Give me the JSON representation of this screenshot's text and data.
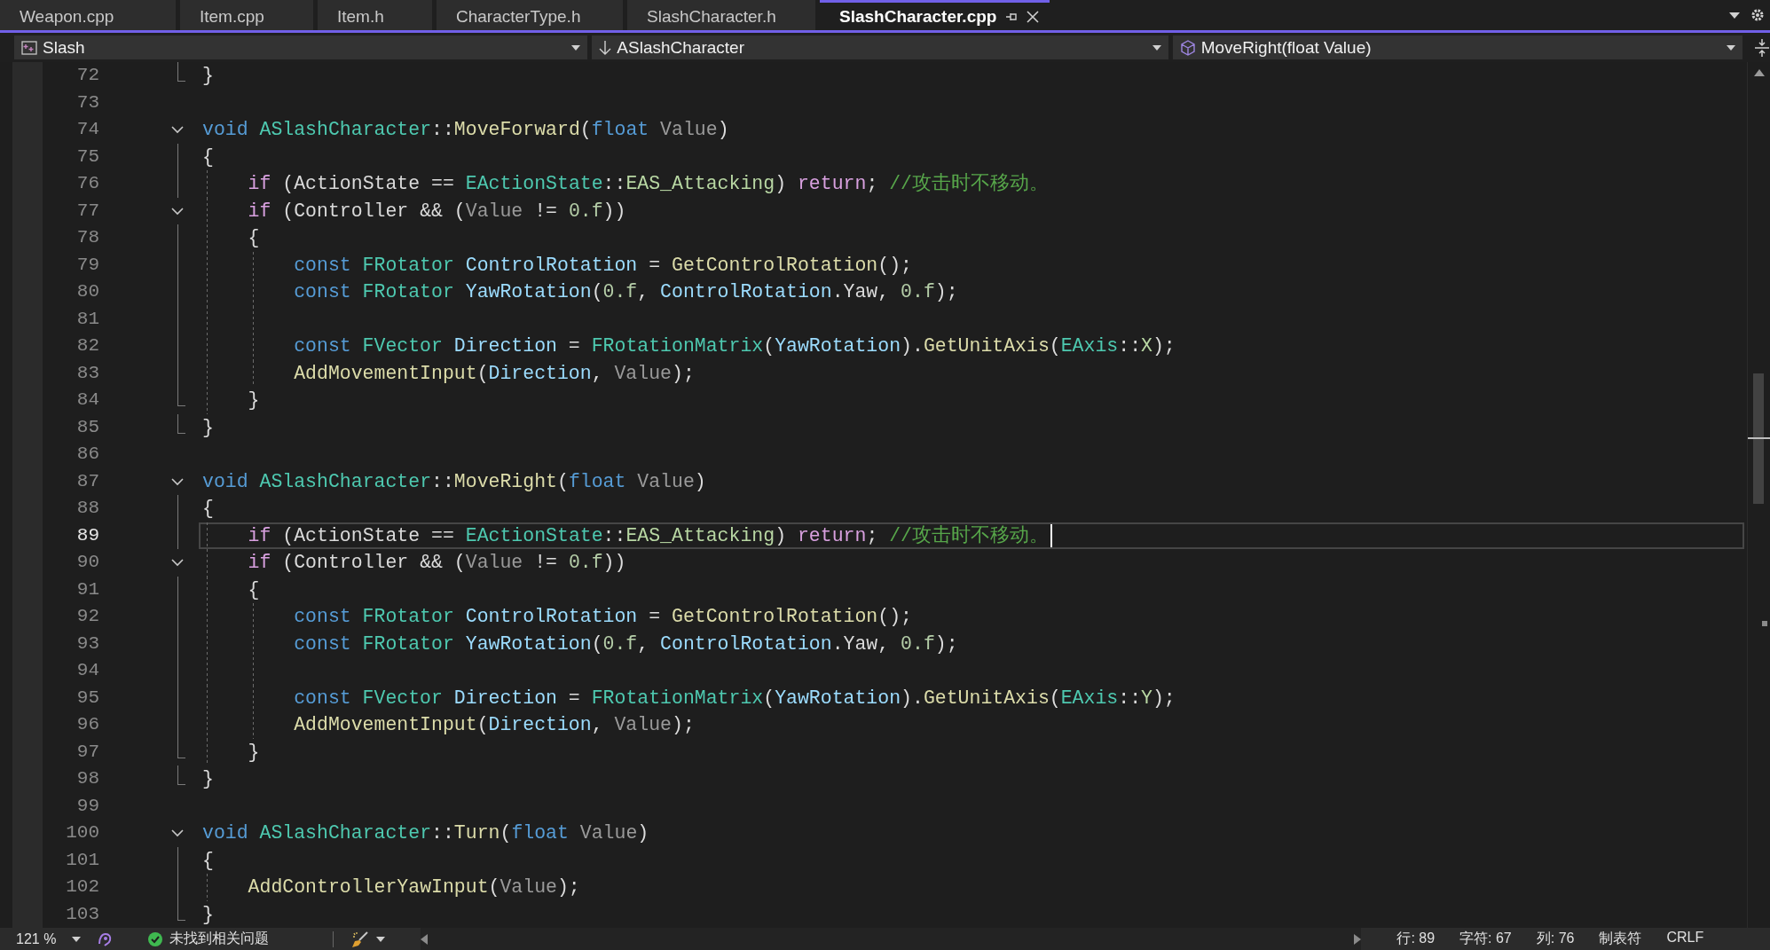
{
  "tabs": [
    {
      "label": "Weapon.cpp",
      "selected": false
    },
    {
      "label": "Item.cpp",
      "selected": false
    },
    {
      "label": "Item.h",
      "selected": false
    },
    {
      "label": "CharacterType.h",
      "selected": false
    },
    {
      "label": "SlashCharacter.h",
      "selected": false
    },
    {
      "label": "SlashCharacter.cpp",
      "selected": true
    }
  ],
  "navigation": {
    "project": "Slash",
    "scope": "ASlashCharacter",
    "member": "MoveRight(float Value)"
  },
  "code_lines": [
    {
      "children": [
        {
          "number": "72",
          "current": false,
          "tokens": [
            {
              "kind": "plain",
              "text": "}"
            }
          ]
        }
      ]
    },
    {
      "number": "73",
      "current": false
    },
    {
      "number": "74",
      "current": false,
      "expanded": true,
      "tokens": [
        {
          "kind": "kw",
          "text": "void"
        },
        {
          "kind": "type",
          "text": " ASlashCharacter"
        },
        {
          "kind": "plain",
          "text": "::"
        },
        {
          "kind": "fn",
          "text": "MoveForward"
        },
        {
          "kind": "plain",
          "text": "("
        },
        {
          "kind": "kw",
          "text": "float"
        },
        {
          "kind": "param",
          "text": " Value"
        },
        {
          "kind": "plain",
          "text": ")"
        }
      ],
      "children": [
        {
          "number": "75",
          "current": false,
          "tokens": [
            {
              "kind": "plain",
              "text": "{"
            }
          ]
        },
        {
          "number": "76",
          "current": false,
          "tokens": [
            {
              "kind": "ctl",
              "text": "    if"
            },
            {
              "kind": "plain",
              "text": " ("
            },
            {
              "kind": "member",
              "text": "ActionState"
            },
            {
              "kind": "plain",
              "text": " == "
            },
            {
              "kind": "type",
              "text": "EActionState"
            },
            {
              "kind": "plain",
              "text": "::"
            },
            {
              "kind": "enum",
              "text": "EAS_Attacking"
            },
            {
              "kind": "plain",
              "text": ") "
            },
            {
              "kind": "ctl",
              "text": "return"
            },
            {
              "kind": "plain",
              "text": ";"
            },
            {
              "kind": "comment",
              "text": " //攻击时不移动。"
            }
          ]
        },
        {
          "number": "77",
          "current": false,
          "expanded": true,
          "tokens": [
            {
              "kind": "ctl",
              "text": "    if"
            },
            {
              "kind": "plain",
              "text": " ("
            },
            {
              "kind": "member",
              "text": "Controller"
            },
            {
              "kind": "plain",
              "text": " && ("
            },
            {
              "kind": "param",
              "text": "Value"
            },
            {
              "kind": "plain",
              "text": " != "
            },
            {
              "kind": "num",
              "text": "0.f"
            },
            {
              "kind": "plain",
              "text": "))"
            }
          ],
          "children": [
            {
              "number": "78",
              "current": false,
              "tokens": [
                {
                  "kind": "plain",
                  "text": "    {"
                }
              ]
            },
            {
              "number": "79",
              "current": false,
              "tokens": [
                {
                  "kind": "kw",
                  "text": "        const"
                },
                {
                  "kind": "type",
                  "text": " FRotator"
                },
                {
                  "kind": "local",
                  "text": " ControlRotation"
                },
                {
                  "kind": "plain",
                  "text": " = "
                },
                {
                  "kind": "fn",
                  "text": "GetControlRotation"
                },
                {
                  "kind": "plain",
                  "text": "();"
                }
              ]
            },
            {
              "number": "80",
              "current": false,
              "tokens": [
                {
                  "kind": "kw",
                  "text": "        const"
                },
                {
                  "kind": "type",
                  "text": " FRotator"
                },
                {
                  "kind": "local",
                  "text": " YawRotation"
                },
                {
                  "kind": "plain",
                  "text": "("
                },
                {
                  "kind": "num",
                  "text": "0.f"
                },
                {
                  "kind": "plain",
                  "text": ", "
                },
                {
                  "kind": "local",
                  "text": "ControlRotation"
                },
                {
                  "kind": "plain",
                  "text": "."
                },
                {
                  "kind": "member",
                  "text": "Yaw"
                },
                {
                  "kind": "plain",
                  "text": ", "
                },
                {
                  "kind": "num",
                  "text": "0.f"
                },
                {
                  "kind": "plain",
                  "text": ");"
                }
              ]
            },
            {
              "number": "81",
              "current": false
            },
            {
              "number": "82",
              "current": false,
              "tokens": [
                {
                  "kind": "kw",
                  "text": "        const"
                },
                {
                  "kind": "type",
                  "text": " FVector"
                },
                {
                  "kind": "local",
                  "text": " Direction"
                },
                {
                  "kind": "plain",
                  "text": " = "
                },
                {
                  "kind": "type",
                  "text": "FRotationMatrix"
                },
                {
                  "kind": "plain",
                  "text": "("
                },
                {
                  "kind": "local",
                  "text": "YawRotation"
                },
                {
                  "kind": "plain",
                  "text": ")."
                },
                {
                  "kind": "fn",
                  "text": "GetUnitAxis"
                },
                {
                  "kind": "plain",
                  "text": "("
                },
                {
                  "kind": "type",
                  "text": "EAxis"
                },
                {
                  "kind": "plain",
                  "text": "::"
                },
                {
                  "kind": "enum",
                  "text": "X"
                },
                {
                  "kind": "plain",
                  "text": ");"
                }
              ]
            },
            {
              "number": "83",
              "current": false,
              "tokens": [
                {
                  "kind": "fn",
                  "text": "        AddMovementInput"
                },
                {
                  "kind": "plain",
                  "text": "("
                },
                {
                  "kind": "local",
                  "text": "Direction"
                },
                {
                  "kind": "plain",
                  "text": ", "
                },
                {
                  "kind": "param",
                  "text": "Value"
                },
                {
                  "kind": "plain",
                  "text": ");"
                }
              ]
            },
            {
              "number": "84",
              "current": false,
              "tokens": [
                {
                  "kind": "plain",
                  "text": "    }"
                }
              ]
            }
          ]
        },
        {
          "number": "85",
          "current": false,
          "tokens": [
            {
              "kind": "plain",
              "text": "}"
            }
          ]
        }
      ]
    },
    {
      "number": "86",
      "current": false
    },
    {
      "number": "87",
      "current": false,
      "expanded": true,
      "tokens": [
        {
          "kind": "kw",
          "text": "void"
        },
        {
          "kind": "type",
          "text": " ASlashCharacter"
        },
        {
          "kind": "plain",
          "text": "::"
        },
        {
          "kind": "fn",
          "text": "MoveRight"
        },
        {
          "kind": "plain",
          "text": "("
        },
        {
          "kind": "kw",
          "text": "float"
        },
        {
          "kind": "param",
          "text": " Value"
        },
        {
          "kind": "plain",
          "text": ")"
        }
      ],
      "children": [
        {
          "number": "88",
          "current": false,
          "tokens": [
            {
              "kind": "plain",
              "text": "{"
            }
          ]
        },
        {
          "number": "89",
          "current": true,
          "tokens": [
            {
              "kind": "ctl",
              "text": "    if"
            },
            {
              "kind": "plain",
              "text": " ("
            },
            {
              "kind": "member",
              "text": "ActionState"
            },
            {
              "kind": "plain",
              "text": " == "
            },
            {
              "kind": "type",
              "text": "EActionState"
            },
            {
              "kind": "plain",
              "text": "::"
            },
            {
              "kind": "enum",
              "text": "EAS_Attacking"
            },
            {
              "kind": "plain",
              "text": ") "
            },
            {
              "kind": "ctl",
              "text": "return"
            },
            {
              "kind": "plain",
              "text": ";"
            },
            {
              "kind": "comment",
              "text": " //攻击时不移动。"
            }
          ]
        },
        {
          "number": "90",
          "current": false,
          "expanded": true,
          "tokens": [
            {
              "kind": "ctl",
              "text": "    if"
            },
            {
              "kind": "plain",
              "text": " ("
            },
            {
              "kind": "member",
              "text": "Controller"
            },
            {
              "kind": "plain",
              "text": " && ("
            },
            {
              "kind": "param",
              "text": "Value"
            },
            {
              "kind": "plain",
              "text": " != "
            },
            {
              "kind": "num",
              "text": "0.f"
            },
            {
              "kind": "plain",
              "text": "))"
            }
          ],
          "children": [
            {
              "number": "91",
              "current": false,
              "tokens": [
                {
                  "kind": "plain",
                  "text": "    {"
                }
              ]
            },
            {
              "number": "92",
              "current": false,
              "tokens": [
                {
                  "kind": "kw",
                  "text": "        const"
                },
                {
                  "kind": "type",
                  "text": " FRotator"
                },
                {
                  "kind": "local",
                  "text": " ControlRotation"
                },
                {
                  "kind": "plain",
                  "text": " = "
                },
                {
                  "kind": "fn",
                  "text": "GetControlRotation"
                },
                {
                  "kind": "plain",
                  "text": "();"
                }
              ]
            },
            {
              "number": "93",
              "current": false,
              "tokens": [
                {
                  "kind": "kw",
                  "text": "        const"
                },
                {
                  "kind": "type",
                  "text": " FRotator"
                },
                {
                  "kind": "local",
                  "text": " YawRotation"
                },
                {
                  "kind": "plain",
                  "text": "("
                },
                {
                  "kind": "num",
                  "text": "0.f"
                },
                {
                  "kind": "plain",
                  "text": ", "
                },
                {
                  "kind": "local",
                  "text": "ControlRotation"
                },
                {
                  "kind": "plain",
                  "text": "."
                },
                {
                  "kind": "member",
                  "text": "Yaw"
                },
                {
                  "kind": "plain",
                  "text": ", "
                },
                {
                  "kind": "num",
                  "text": "0.f"
                },
                {
                  "kind": "plain",
                  "text": ");"
                }
              ]
            },
            {
              "number": "94",
              "current": false
            },
            {
              "number": "95",
              "current": false,
              "tokens": [
                {
                  "kind": "kw",
                  "text": "        const"
                },
                {
                  "kind": "type",
                  "text": " FVector"
                },
                {
                  "kind": "local",
                  "text": " Direction"
                },
                {
                  "kind": "plain",
                  "text": " = "
                },
                {
                  "kind": "type",
                  "text": "FRotationMatrix"
                },
                {
                  "kind": "plain",
                  "text": "("
                },
                {
                  "kind": "local",
                  "text": "YawRotation"
                },
                {
                  "kind": "plain",
                  "text": ")."
                },
                {
                  "kind": "fn",
                  "text": "GetUnitAxis"
                },
                {
                  "kind": "plain",
                  "text": "("
                },
                {
                  "kind": "type",
                  "text": "EAxis"
                },
                {
                  "kind": "plain",
                  "text": "::"
                },
                {
                  "kind": "enum",
                  "text": "Y"
                },
                {
                  "kind": "plain",
                  "text": ");"
                }
              ]
            },
            {
              "number": "96",
              "current": false,
              "tokens": [
                {
                  "kind": "fn",
                  "text": "        AddMovementInput"
                },
                {
                  "kind": "plain",
                  "text": "("
                },
                {
                  "kind": "local",
                  "text": "Direction"
                },
                {
                  "kind": "plain",
                  "text": ", "
                },
                {
                  "kind": "param",
                  "text": "Value"
                },
                {
                  "kind": "plain",
                  "text": ");"
                }
              ]
            },
            {
              "number": "97",
              "current": false,
              "tokens": [
                {
                  "kind": "plain",
                  "text": "    }"
                }
              ]
            }
          ]
        },
        {
          "number": "98",
          "current": false,
          "tokens": [
            {
              "kind": "plain",
              "text": "}"
            }
          ]
        }
      ]
    },
    {
      "number": "99",
      "current": false
    },
    {
      "number": "100",
      "current": false,
      "expanded": true,
      "tokens": [
        {
          "kind": "kw",
          "text": "void"
        },
        {
          "kind": "type",
          "text": " ASlashCharacter"
        },
        {
          "kind": "plain",
          "text": "::"
        },
        {
          "kind": "fn",
          "text": "Turn"
        },
        {
          "kind": "plain",
          "text": "("
        },
        {
          "kind": "kw",
          "text": "float"
        },
        {
          "kind": "param",
          "text": " Value"
        },
        {
          "kind": "plain",
          "text": ")"
        }
      ],
      "children": [
        {
          "number": "101",
          "current": false,
          "tokens": [
            {
              "kind": "plain",
              "text": "{"
            }
          ]
        },
        {
          "number": "102",
          "current": false,
          "tokens": [
            {
              "kind": "fn",
              "text": "    AddControllerYawInput"
            },
            {
              "kind": "plain",
              "text": "("
            },
            {
              "kind": "param",
              "text": "Value"
            },
            {
              "kind": "plain",
              "text": ");"
            }
          ]
        },
        {
          "number": "103",
          "current": false,
          "tokens": [
            {
              "kind": "plain",
              "text": "}"
            }
          ]
        }
      ]
    }
  ],
  "status_bar": {
    "zoom": "121 %",
    "issues": "未找到相关问题",
    "line": "行: 89",
    "char": "字符: 67",
    "column": "列: 76",
    "indent_mode": "制表符",
    "line_ending": "CRLF"
  }
}
